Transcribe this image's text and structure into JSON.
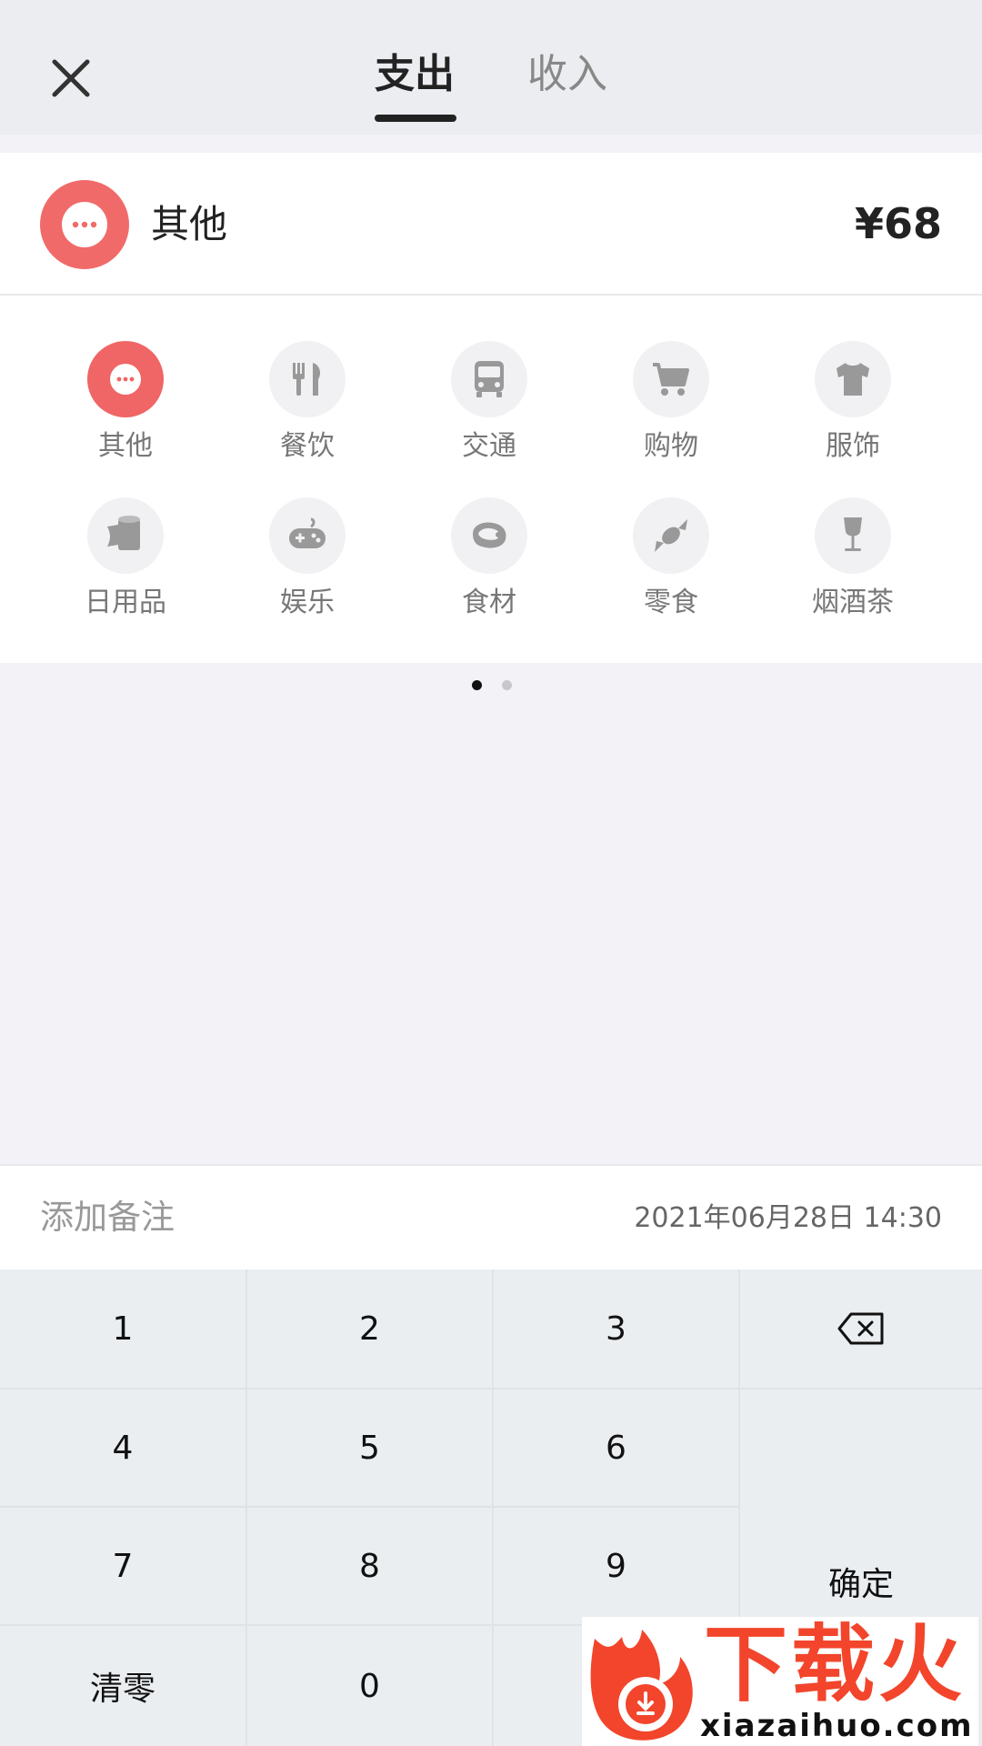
{
  "header": {
    "tabs": [
      {
        "label": "支出",
        "active": true
      },
      {
        "label": "收入",
        "active": false
      }
    ]
  },
  "selected": {
    "category_label": "其他",
    "amount": "¥68",
    "icon": "more-dots-icon",
    "accent_color": "#f16a6a"
  },
  "categories": [
    {
      "label": "其他",
      "icon": "more-dots-icon",
      "selected": true
    },
    {
      "label": "餐饮",
      "icon": "fork-knife-icon",
      "selected": false
    },
    {
      "label": "交通",
      "icon": "bus-icon",
      "selected": false
    },
    {
      "label": "购物",
      "icon": "shopping-cart-icon",
      "selected": false
    },
    {
      "label": "服饰",
      "icon": "tshirt-icon",
      "selected": false
    },
    {
      "label": "日用品",
      "icon": "toilet-paper-icon",
      "selected": false
    },
    {
      "label": "娱乐",
      "icon": "gamepad-icon",
      "selected": false
    },
    {
      "label": "食材",
      "icon": "meat-icon",
      "selected": false
    },
    {
      "label": "零食",
      "icon": "candy-icon",
      "selected": false
    },
    {
      "label": "烟酒茶",
      "icon": "wine-glass-icon",
      "selected": false
    }
  ],
  "pager": {
    "page_count": 2,
    "current_page": 1
  },
  "notes": {
    "placeholder": "添加备注",
    "datetime": "2021年06月28日 14:30"
  },
  "keypad": {
    "keys": [
      "1",
      "2",
      "3",
      "4",
      "5",
      "6",
      "7",
      "8",
      "9",
      "清零",
      "0"
    ],
    "confirm_label": "确定",
    "backspace_icon": "backspace-icon"
  },
  "watermark": {
    "text": "下载火",
    "url": "xiazaihuo.com"
  }
}
